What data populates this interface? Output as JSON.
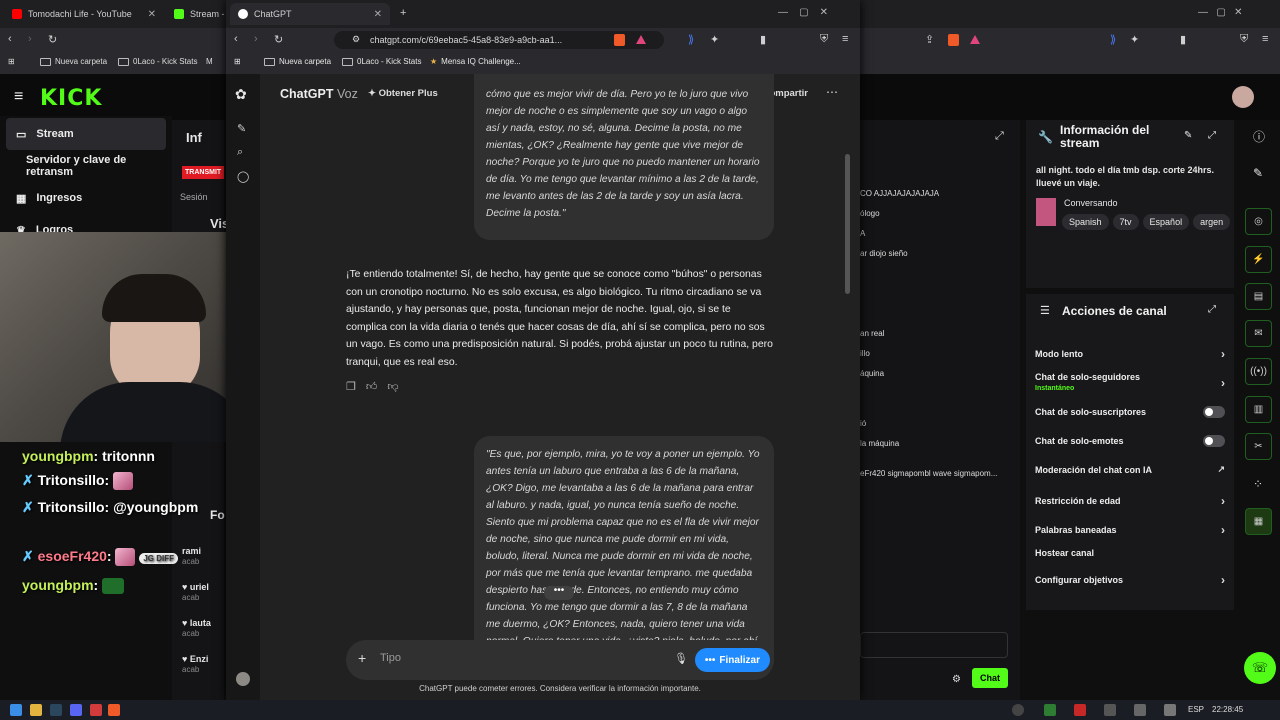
{
  "back_browser": {
    "tabs": [
      {
        "label": "Tomodachi Life - YouTube",
        "color": "#ff0000"
      },
      {
        "label": "Stream - K",
        "color": "#53fc18"
      }
    ],
    "bookmarks": [
      "Nueva carpeta",
      "0Laco - Kick Stats",
      "M"
    ],
    "logo": "KICK",
    "sidebar": [
      {
        "label": "Stream",
        "icon": "stream-icon",
        "active": true
      },
      {
        "label": "Servidor y clave de retransm",
        "icon": "",
        "active": false
      },
      {
        "label": "Ingresos",
        "icon": "money-icon",
        "active": false
      },
      {
        "label": "Logros",
        "icon": "trophy-icon",
        "active": false
      }
    ],
    "mid_labels": {
      "info": "Inf",
      "transmit": "TRANSMIT",
      "session": "Sesión",
      "vis": "Vis",
      "fo": "Fo"
    },
    "followers": [
      {
        "name": "rami",
        "sub": "acab"
      },
      {
        "name": "uriel",
        "sub": "acab"
      },
      {
        "name": "lauta",
        "sub": "acab"
      },
      {
        "name": "Enzi",
        "sub": "acab"
      }
    ],
    "chat_column": [
      "CO AJJAJAJAJAJAJA",
      "ólogo",
      "A",
      "ar diojo sieño",
      "an real",
      "illo",
      "áquina",
      "ió",
      "la máquina",
      "eFr420 sigmapombl wave sigmapom..."
    ],
    "stream_info": {
      "title": "Información del stream",
      "description": "all night. todo el día tmb dsp. corte 24hrs. lluevé un viaje.",
      "category": "Conversando",
      "tags": [
        "Spanish",
        "7tv",
        "Español",
        "argen"
      ]
    },
    "channel_actions": {
      "title": "Acciones de canal",
      "items": [
        {
          "label": "Modo lento",
          "sub": "",
          "kind": "chevron"
        },
        {
          "label": "Chat de solo-seguidores",
          "sub": "Instantáneo",
          "kind": "chevron"
        },
        {
          "label": "Chat de solo-suscriptores",
          "sub": "",
          "kind": "toggle"
        },
        {
          "label": "Chat de solo-emotes",
          "sub": "",
          "kind": "toggle"
        },
        {
          "label": "Moderación del chat con IA",
          "sub": "",
          "kind": "external"
        },
        {
          "label": "Restricción de edad",
          "sub": "",
          "kind": "chevron"
        },
        {
          "label": "Palabras baneadas",
          "sub": "",
          "kind": "chevron"
        },
        {
          "label": "Hostear canal",
          "sub": "",
          "kind": "none"
        },
        {
          "label": "Configurar objetivos",
          "sub": "",
          "kind": "chevron"
        }
      ]
    },
    "chat_button": "Chat",
    "overlay_chat": [
      {
        "user": "youngbpm",
        "msg": "tritonnn"
      },
      {
        "user": "Tritonsillo",
        "msg": ""
      },
      {
        "user": "Tritonsillo",
        "msg": "@youngbpm"
      },
      {
        "user": "esoeFr420",
        "msg": "JG DIFF"
      },
      {
        "user": "youngbpm",
        "msg": ""
      }
    ]
  },
  "chatgpt": {
    "tab_label": "ChatGPT",
    "url": "chatgpt.com/c/69eebac5-45a8-83e9-a9cb-aa1...",
    "bookmarks": [
      "Nueva carpeta",
      "0Laco - Kick Stats",
      "Mensa IQ Challenge..."
    ],
    "header": {
      "title": "ChatGPT",
      "mode": "Voz",
      "upgrade": "Obtener Plus",
      "share": "Compartir"
    },
    "user_message_1": "cómo que es mejor vivir de día. Pero yo te lo juro que vivo mejor de noche o es simplemente que soy un vago o algo así y nada, estoy, no sé, alguna. Decime la posta, no me mientas, ¿OK? ¿Realmente hay gente que vive mejor de noche? Porque yo te juro que no puedo mantener un horario de día. Yo me tengo que levantar mínimo a las 2 de la tarde, me levanto antes de las 2 de la tarde y soy un asía lacra. Decime la posta.\"",
    "assistant_message": "¡Te entiendo totalmente! Sí, de hecho, hay gente que se conoce como \"búhos\" o personas con un cronotipo nocturno. No es solo excusa, es algo biológico. Tu ritmo circadiano se va ajustando, y hay personas que, posta, funcionan mejor de noche. Igual, ojo, si se te complica con la vida diaria o tenés que hacer cosas de día, ahí sí se complica, pero no sos un vago. Es como una predisposición natural. Si podés, probá ajustar un poco tu rutina, pero tranqui, que es real eso.",
    "user_message_2": "\"Es que, por ejemplo, mira, yo te voy a poner un ejemplo. Yo antes tenía un laburo que entraba a las 6 de la mañana, ¿OK? Digo, me levantaba a las 6 de la mañana para entrar al laburo. y nada, igual, yo nunca tenía sueño de noche. Siento que mi problema capaz que no es el fla de vivir mejor de noche, sino que nunca me pude dormir en mi vida, boludo, literal. Nunca me pude dormir en mi vida de noche, por más que me tenía que levantar temprano. me quedaba despierto hasta tarde. Entonces, no entiendo muy cómo funciona. Yo me tengo que dormir a las 7, 8 de la mañana me duermo, ¿OK? Entonces, nada, quiero tener una vida normal. Quiero tener una vida, ¿viste? piola, boludo, por ahí",
    "composer_placeholder": "Tipo",
    "finalize": "Finalizar",
    "disclaimer": "ChatGPT puede cometer errores. Considera verificar la información importante."
  },
  "taskbar": {
    "lang": "ESP",
    "time": "22:28:45"
  }
}
